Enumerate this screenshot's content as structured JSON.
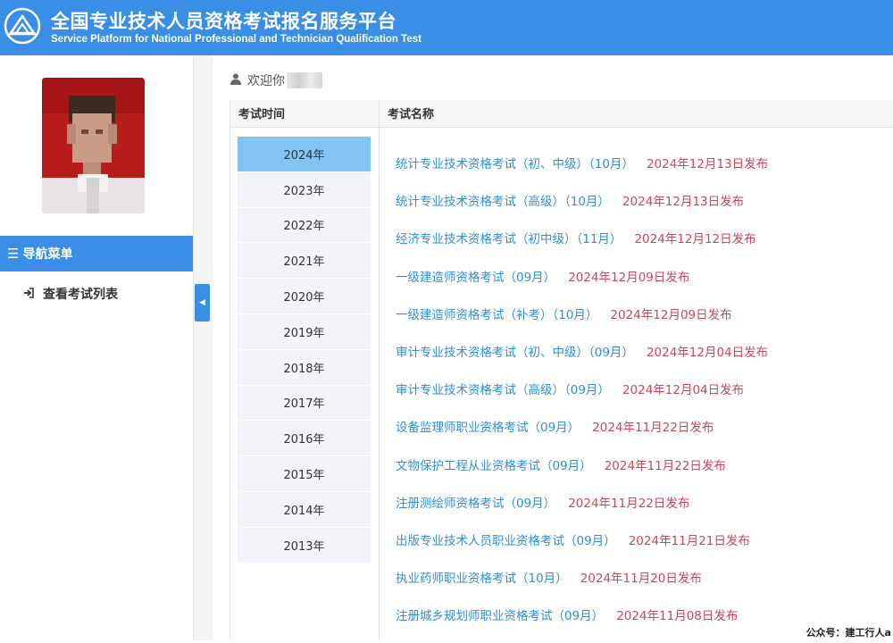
{
  "header": {
    "title_cn": "全国专业技术人员资格考试报名服务平台",
    "title_en": "Service Platform for National Professional and Technician Qualification Test"
  },
  "sidebar": {
    "nav_title": "导航菜单",
    "items": [
      {
        "label": "查看考试列表",
        "icon": "sign-in-icon"
      }
    ]
  },
  "welcome": {
    "label": "欢迎你"
  },
  "table": {
    "col_time": "考试时间",
    "col_name": "考试名称",
    "years": [
      "2024年",
      "2023年",
      "2022年",
      "2021年",
      "2020年",
      "2019年",
      "2018年",
      "2017年",
      "2016年",
      "2015年",
      "2014年",
      "2013年"
    ],
    "selected_year": "2024年",
    "exams": [
      {
        "name": "统计专业技术资格考试（初、中级）（10月）",
        "date": "2024年12月13日发布"
      },
      {
        "name": "统计专业技术资格考试（高级）（10月）",
        "date": "2024年12月13日发布"
      },
      {
        "name": "经济专业技术资格考试（初中级）（11月）",
        "date": "2024年12月12日发布"
      },
      {
        "name": "一级建造师资格考试（09月）",
        "date": "2024年12月09日发布"
      },
      {
        "name": "一级建造师资格考试（补考）（10月）",
        "date": "2024年12月09日发布"
      },
      {
        "name": "审计专业技术资格考试（初、中级）（09月）",
        "date": "2024年12月04日发布"
      },
      {
        "name": "审计专业技术资格考试（高级）（09月）",
        "date": "2024年12月04日发布"
      },
      {
        "name": "设备监理师职业资格考试（09月）",
        "date": "2024年11月22日发布"
      },
      {
        "name": "文物保护工程从业资格考试（09月）",
        "date": "2024年11月22日发布"
      },
      {
        "name": "注册测绘师资格考试（09月）",
        "date": "2024年11月22日发布"
      },
      {
        "name": "出版专业技术人员职业资格考试（09月）",
        "date": "2024年11月21日发布"
      },
      {
        "name": "执业药师职业资格考试（10月）",
        "date": "2024年11月20日发布"
      },
      {
        "name": "注册城乡规划师职业资格考试（09月）",
        "date": "2024年11月08日发布"
      }
    ]
  },
  "watermark": "公众号：建工行人a",
  "colors": {
    "header_blue": "#3a8ee6",
    "link_blue": "#2f8fd6",
    "date_red": "#c9485b",
    "active_year": "#82c5f3"
  }
}
